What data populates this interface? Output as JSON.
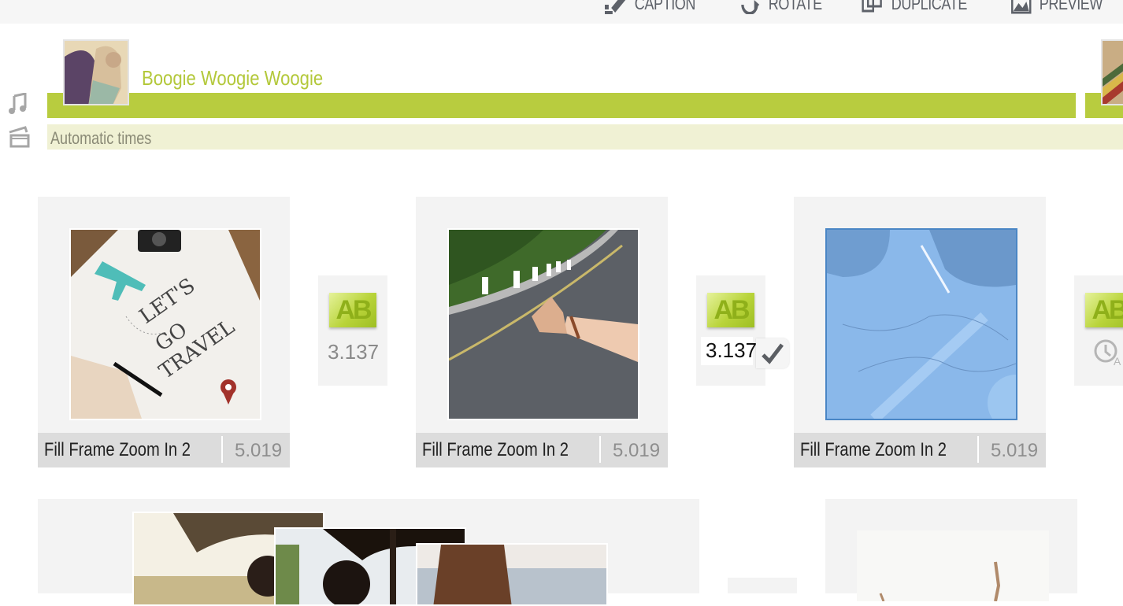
{
  "toolbar": {
    "buttons": [
      {
        "label": "CAPTION",
        "icon": "caption-pencil-icon"
      },
      {
        "label": "ROTATE",
        "icon": "rotate-icon"
      },
      {
        "label": "DUPLICATE",
        "icon": "duplicate-icon"
      },
      {
        "label": "PREVIEW",
        "icon": "preview-image-icon"
      }
    ]
  },
  "music": {
    "track_title": "Boogie Woogie Woogie",
    "bar_color": "#b8cc3f"
  },
  "timing": {
    "label": "Automatic times"
  },
  "slides": [
    {
      "effect": "Fill Frame Zoom In 2",
      "duration": "5.019",
      "image": "lets-go-travel",
      "selected": false
    },
    {
      "effect": "Fill Frame Zoom In 2",
      "duration": "5.019",
      "image": "hitchhiking-road",
      "selected": false
    },
    {
      "effect": "Fill Frame Zoom In 2",
      "duration": "5.019",
      "image": "map-travel",
      "selected": true
    }
  ],
  "transitions": [
    {
      "label": "AB",
      "duration": "3.137",
      "editing": false
    },
    {
      "label": "AB",
      "duration": "3.137",
      "editing": true
    },
    {
      "label": "AB",
      "duration": "",
      "editing": false,
      "auto": true
    }
  ],
  "colors": {
    "accent": "#b8cc3f",
    "selection": "#4a86c5"
  }
}
